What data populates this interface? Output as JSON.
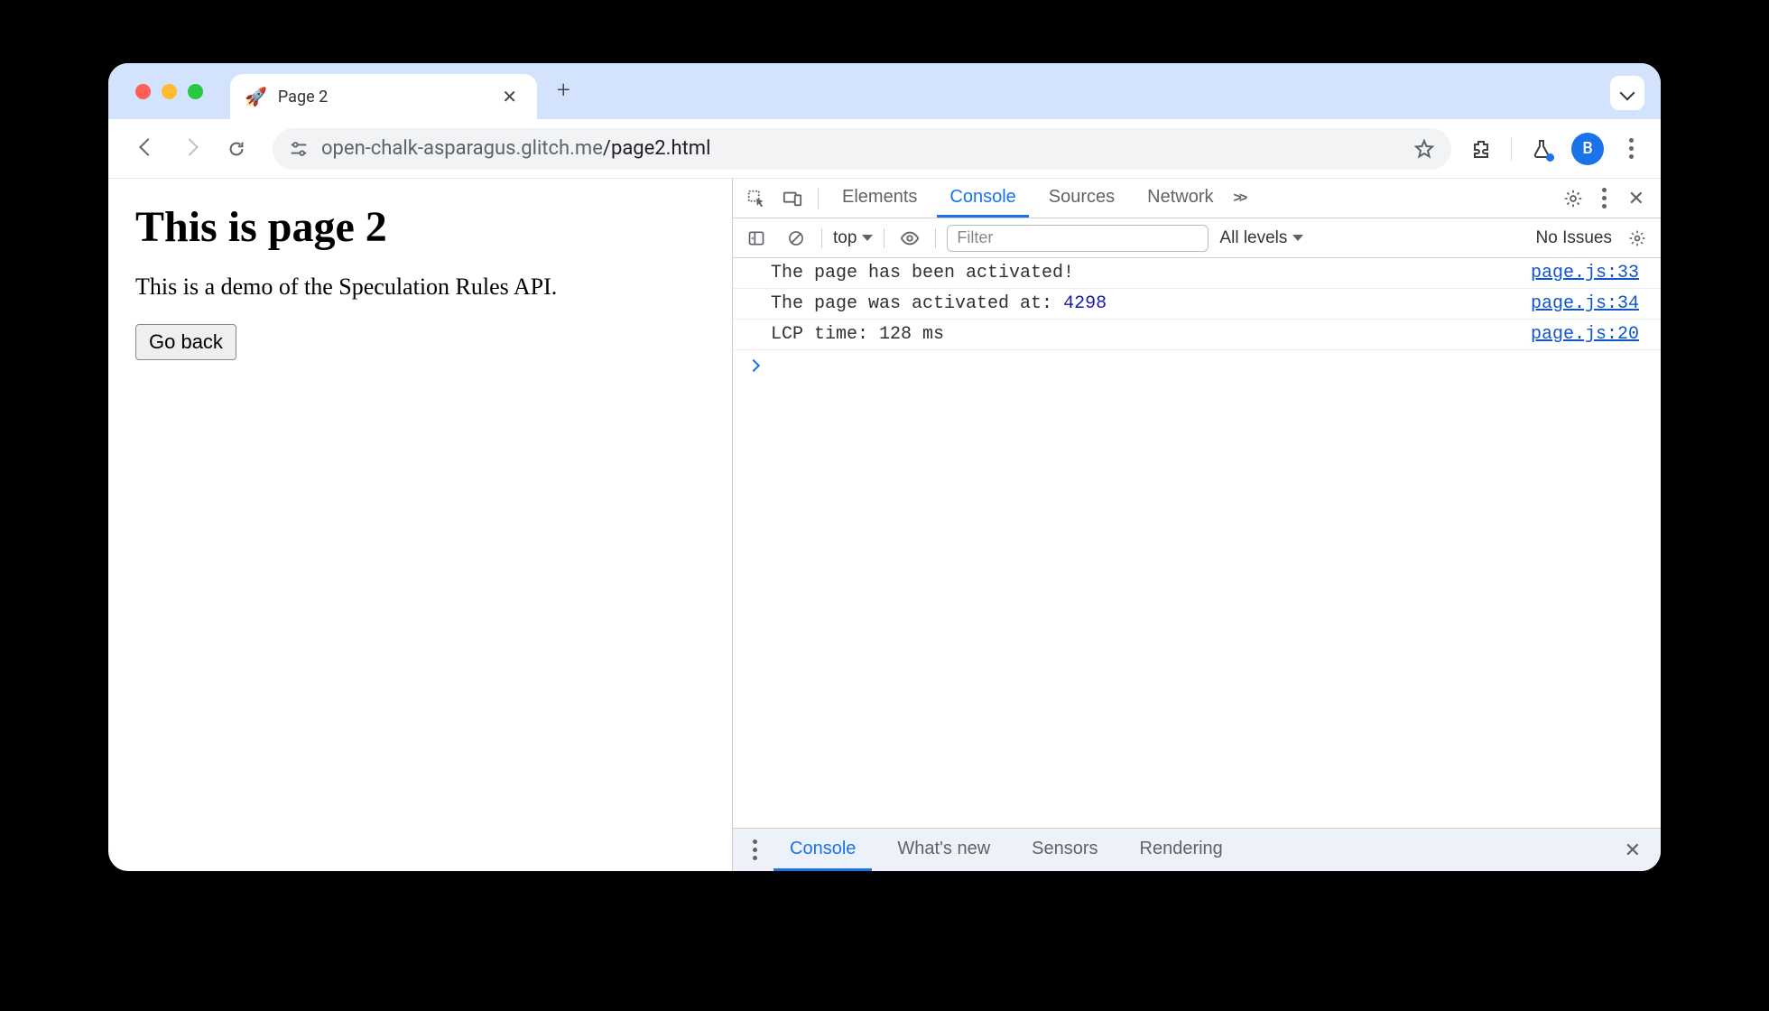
{
  "tab": {
    "favicon": "🚀",
    "title": "Page 2"
  },
  "omnibox": {
    "host": "open-chalk-asparagus.glitch.me",
    "path": "/page2.html"
  },
  "avatar_letter": "B",
  "page": {
    "heading": "This is page 2",
    "subtext": "This is a demo of the Speculation Rules API.",
    "back_button": "Go back"
  },
  "devtools": {
    "tabs": [
      "Elements",
      "Console",
      "Sources",
      "Network"
    ],
    "active_tab": "Console",
    "console_toolbar": {
      "context": "top",
      "filter_placeholder": "Filter",
      "levels": "All levels",
      "issues": "No Issues"
    },
    "logs": [
      {
        "msg": "The page has been activated!",
        "num": "",
        "src": "page.js:33"
      },
      {
        "msg": "The page was activated at: ",
        "num": "4298",
        "src": "page.js:34"
      },
      {
        "msg": "LCP time: 128 ms",
        "num": "",
        "src": "page.js:20"
      }
    ],
    "drawer_tabs": [
      "Console",
      "What's new",
      "Sensors",
      "Rendering"
    ],
    "drawer_active": "Console"
  }
}
